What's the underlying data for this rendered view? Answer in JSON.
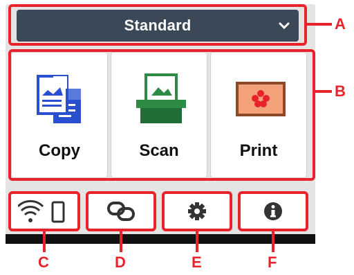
{
  "mode_selector": {
    "label": "Standard",
    "icon": "chevron-down-icon"
  },
  "tiles": [
    {
      "label": "Copy",
      "icon": "copy-icon"
    },
    {
      "label": "Scan",
      "icon": "scan-icon"
    },
    {
      "label": "Print",
      "icon": "print-icon"
    }
  ],
  "bottom_buttons": [
    {
      "icon": "wifi-device-icon"
    },
    {
      "icon": "link-icon"
    },
    {
      "icon": "gear-icon"
    },
    {
      "icon": "info-icon"
    }
  ],
  "callouts": {
    "a": "A",
    "b": "B",
    "c": "C",
    "d": "D",
    "e": "E",
    "f": "F"
  },
  "colors": {
    "highlight": "#e8232b",
    "header": "#3b4857"
  }
}
